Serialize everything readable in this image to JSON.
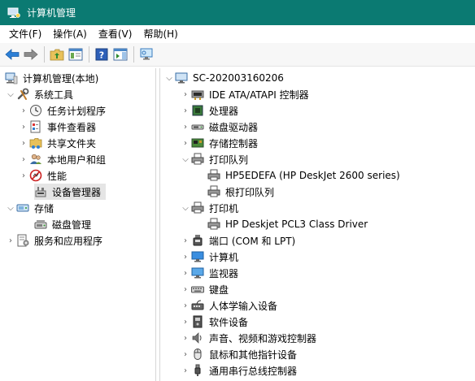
{
  "window": {
    "title": "计算机管理"
  },
  "menu": {
    "file": "文件(F)",
    "action": "操作(A)",
    "view": "查看(V)",
    "help": "帮助(H)"
  },
  "left_tree": {
    "root": "计算机管理(本地)",
    "system_tools": "系统工具",
    "task_scheduler": "任务计划程序",
    "event_viewer": "事件查看器",
    "shared_folders": "共享文件夹",
    "local_users": "本地用户和组",
    "performance": "性能",
    "device_manager": "设备管理器",
    "storage": "存储",
    "disk_management": "磁盘管理",
    "services_apps": "服务和应用程序"
  },
  "devices": {
    "computer_name": "SC-202003160206",
    "ide": "IDE ATA/ATAPI 控制器",
    "processors": "处理器",
    "disk_drives": "磁盘驱动器",
    "storage_controllers": "存储控制器",
    "print_queues": "打印队列",
    "print_queue_hp": "HP5EDEFA (HP DeskJet 2600 series)",
    "print_queue_root": "根打印队列",
    "printers": "打印机",
    "printer_hp": "HP Deskjet PCL3 Class Driver",
    "ports": "端口 (COM 和 LPT)",
    "computer": "计算机",
    "monitors": "监视器",
    "keyboards": "键盘",
    "hid": "人体学输入设备",
    "software_devices": "软件设备",
    "sound": "声音、视频和游戏控制器",
    "mice": "鼠标和其他指针设备",
    "usb": "通用串行总线控制器"
  },
  "colors": {
    "titlebar": "#0b7a72",
    "accent": "#1a6fc9"
  }
}
